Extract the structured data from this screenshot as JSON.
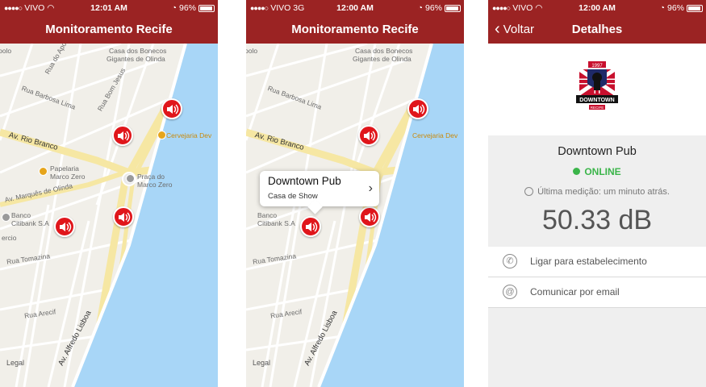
{
  "colors": {
    "brand": "#9b2323",
    "pin": "#e0161b",
    "online": "#3bb54a",
    "water": "#a8d6f7",
    "road": "#f6e7a3"
  },
  "screen1": {
    "status": {
      "carrier": "VIVO",
      "network": "",
      "time": "12:01 AM",
      "battery": "96%"
    },
    "title": "Monitoramento Recife",
    "map_labels": {
      "polo": "polo",
      "bonecos1": "Casa dos Bonecos",
      "bonecos2": "Gigantes de Olinda",
      "apolo": "Rua do Apolo",
      "barbosa": "Rua Barbosa Lima",
      "bomjesus": "Rua Bom Jesus",
      "cervejaria": "Cervejaria Dev",
      "riobranco": "Av. Rio Branco",
      "papelaria1": "Papelaria",
      "papelaria2": "Marco Zero",
      "praca1": "Praça do",
      "praca2": "Marco Zero",
      "marques": "Av. Marquês de Olinda",
      "banco1": "Banco",
      "banco2": "Citibank S.A",
      "comercio": "ercio",
      "tomazina": "Rua Tomazina",
      "arecif": "Rua Arecif",
      "lisboa": "Av. Alfredo Lisboa",
      "legal": "Legal"
    }
  },
  "screen2": {
    "status": {
      "carrier": "VIVO",
      "network": "3G",
      "time": "12:00 AM",
      "battery": "96%"
    },
    "title": "Monitoramento Recife",
    "callout": {
      "title": "Downtown Pub",
      "subtitle": "Casa de Show"
    }
  },
  "screen3": {
    "status": {
      "carrier": "VIVO",
      "network": "",
      "time": "12:00 AM",
      "battery": "96%"
    },
    "back_label": "Voltar",
    "title": "Detalhes",
    "logo_year": "1997",
    "logo_text": "DOWNTOWN",
    "logo_sub": "RECIFE",
    "venue_name": "Downtown Pub",
    "status_text": "ONLINE",
    "last_measure": "Última medição:  um minuto atrás.",
    "value": "50.33 dB",
    "actions": [
      {
        "label": "Ligar para estabelecimento",
        "icon": "phone-icon"
      },
      {
        "label": "Comunicar por email",
        "icon": "at-icon"
      }
    ]
  }
}
